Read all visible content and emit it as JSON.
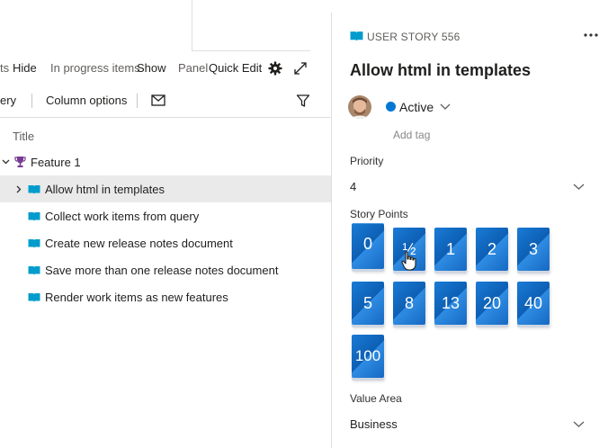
{
  "left_panel": {
    "toolbar": {
      "hide_prefix": "ts",
      "hide_label": "Hide",
      "in_progress_label": "In progress items",
      "show_label": "Show",
      "panel_label": "Panel",
      "quick_edit_label": "Quick Edit"
    },
    "toolbar2": {
      "query_fragment": "ery",
      "column_options": "Column options"
    },
    "column_header": "Title",
    "feature": {
      "label": "Feature 1"
    },
    "items": [
      {
        "label": "Allow html in templates",
        "selected": true
      },
      {
        "label": "Collect work items from query"
      },
      {
        "label": "Create new release notes document"
      },
      {
        "label": "Save more than one release notes document"
      },
      {
        "label": "Render work items as new features"
      }
    ]
  },
  "work_item": {
    "type_label": "USER STORY 556",
    "title": "Allow html in templates",
    "state": "Active",
    "state_color": "#0078d4",
    "add_tag": "Add tag",
    "fields": {
      "priority_label": "Priority",
      "priority_value": "4",
      "story_points_label": "Story Points",
      "story_points": [
        "0",
        "½",
        "1",
        "2",
        "3",
        "5",
        "8",
        "13",
        "20",
        "40",
        "100"
      ],
      "value_area_label": "Value Area",
      "value_area_value": "Business"
    }
  },
  "colors": {
    "accent": "#0078d4",
    "selected_row": "#eaeaea",
    "feature_icon": "#773b93"
  }
}
